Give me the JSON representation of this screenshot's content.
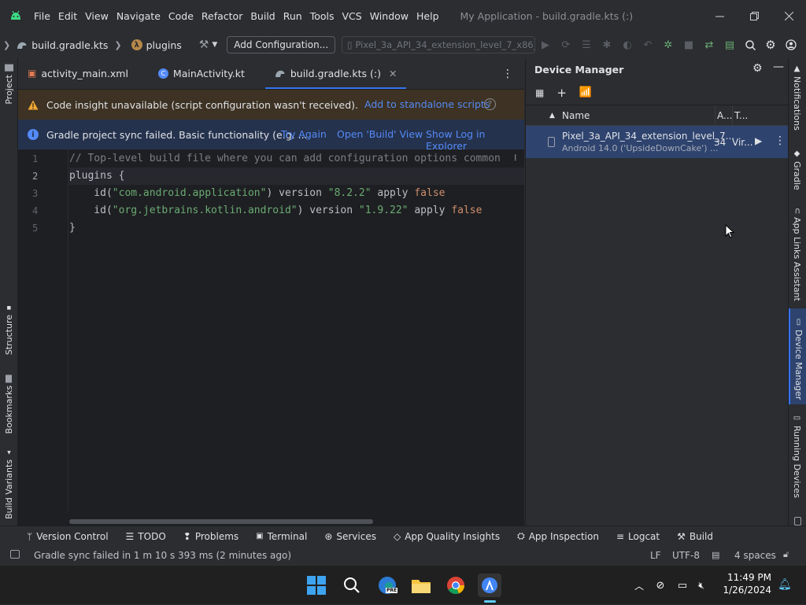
{
  "window": {
    "title": "My Application - build.gradle.kts (:)",
    "menu": [
      "File",
      "Edit",
      "View",
      "Navigate",
      "Code",
      "Refactor",
      "Build",
      "Run",
      "Tools",
      "VCS",
      "Window",
      "Help"
    ]
  },
  "toolbar": {
    "breadcrumb_file": "build.gradle.kts",
    "breadcrumb_symbol": "plugins",
    "add_configuration": "Add Configuration...",
    "device_selector": "Pixel_3a_API_34_extension_level_7_x86_..."
  },
  "left_tools": [
    "Project",
    "Structure",
    "Bookmarks",
    "Build Variants"
  ],
  "right_tools": [
    "Notifications",
    "Gradle",
    "App Links Assistant",
    "Device Manager",
    "Running Devices"
  ],
  "tabs": [
    {
      "label": "activity_main.xml",
      "active": false
    },
    {
      "label": "MainActivity.kt",
      "active": false
    },
    {
      "label": "build.gradle.kts (:)",
      "active": true
    }
  ],
  "banners": {
    "warning": {
      "text": "Code insight unavailable (script configuration wasn't received).",
      "link": "Add to standalone scripts"
    },
    "info": {
      "text": "Gradle project sync failed. Basic functionality (e.g. ...",
      "links": [
        "Try Again",
        "Open 'Build' View",
        "Show Log in Explorer"
      ]
    }
  },
  "code": {
    "line_numbers": [
      "1",
      "2",
      "3",
      "4",
      "5"
    ],
    "comment": "// Top-level build file where you can add configuration options common",
    "l2": "plugins {",
    "l3_prefix": "    id(",
    "l3_str": "\"com.android.application\"",
    "l3_mid": ") version ",
    "l3_ver": "\"8.2.2\"",
    "l3_apply": " apply ",
    "l3_kw": "false",
    "l4_prefix": "    id(",
    "l4_str": "\"org.jetbrains.kotlin.android\"",
    "l4_mid": ") version ",
    "l4_ver": "\"1.9.22\"",
    "l4_apply": " apply ",
    "l4_kw": "false",
    "l5": "}"
  },
  "device_manager": {
    "title": "Device Manager",
    "col_name": "Name",
    "col_api": "A...",
    "col_type": "T...",
    "device": {
      "name": "Pixel_3a_API_34_extension_level_7...",
      "subtitle": "Android 14.0 ('UpsideDownCake') ...",
      "api": "34",
      "type": "Vir..."
    }
  },
  "bottom_tools": [
    "Version Control",
    "TODO",
    "Problems",
    "Terminal",
    "Services",
    "App Quality Insights",
    "App Inspection",
    "Logcat",
    "Build"
  ],
  "status": {
    "message": "Gradle sync failed in 1 m 10 s 393 ms (2 minutes ago)",
    "line_sep": "LF",
    "encoding": "UTF-8",
    "indent": "4 spaces"
  },
  "taskbar": {
    "time": "11:49 PM",
    "date": "1/26/2024",
    "edge_badge": "PRE"
  },
  "colors": {
    "accent": "#3574f0",
    "link": "#548af7",
    "warning_bg": "#3d3223",
    "info_bg": "#25324d",
    "selection": "#2e436e"
  }
}
